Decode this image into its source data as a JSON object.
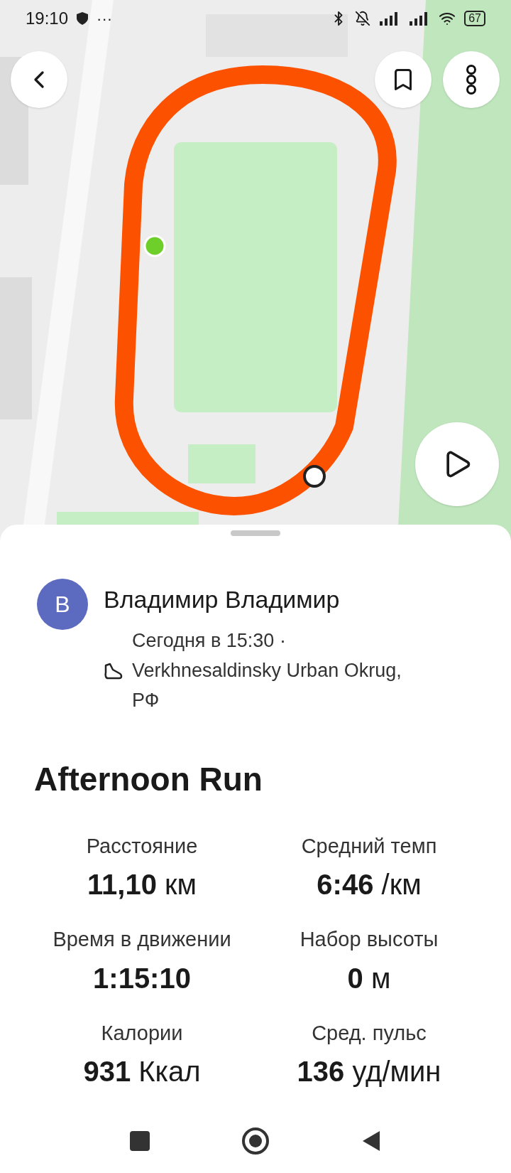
{
  "status_bar": {
    "time": "19:10",
    "dots": "···",
    "battery": "67"
  },
  "activity": {
    "avatar_letter": "В",
    "athlete": "Владимир Владимир",
    "date": "Сегодня в 15:30 ·",
    "location": "Verkhnesaldinsky Urban Okrug, РФ",
    "title": "Afternoon Run"
  },
  "stats": [
    {
      "label": "Расстояние",
      "value": "**11,10** км"
    },
    {
      "label": "Средний темп",
      "value": "**6:46** /км"
    },
    {
      "label": "Время в движении",
      "value": "**1:15:10**"
    },
    {
      "label": "Набор высоты",
      "value": "**0** м"
    },
    {
      "label": "Калории",
      "value": "**931** Ккал"
    },
    {
      "label": "Сред. пульс",
      "value": "**136** уд/мин"
    }
  ]
}
